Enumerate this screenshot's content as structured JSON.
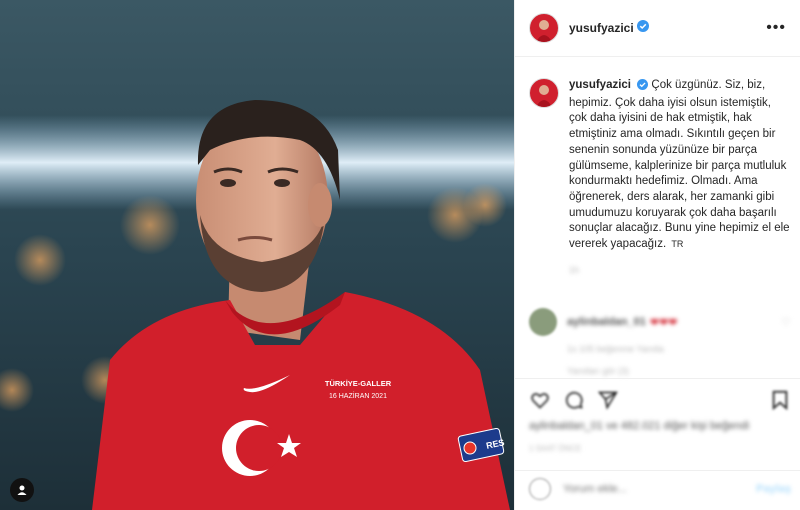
{
  "post": {
    "photo_alt": "",
    "jersey_text_line1": "TÜRKİYE-GALLER",
    "jersey_text_line2": "16 HAZİRAN 2021",
    "sleeve_badge": "RES"
  },
  "header": {
    "username": "yusufyazici",
    "more_label": "•••"
  },
  "caption": {
    "username": "yusufyazici",
    "text": "Çok üzgünüz. Siz, biz, hepimiz. Çok daha iyisi olsun istemiştik, çok daha iyisini de hak etmiştik, hak etmiştiniz ama olmadı. Sıkıntılı geçen bir senenin sonunda yüzünüze bir parça gülümseme, kalplerinize bir parça mutluluk kondurmaktı hedefimiz. Olmadı. Ama öğrenerek, ders alarak, her zamanki gibi umudumuzu koruyarak çok daha başarılı sonuçlar alacağız. Bunu yine hepimiz el ele vererek yapacağız.",
    "lang_badge": "TR",
    "time_blurred": "1h"
  },
  "comment": {
    "username_blurred": "aylinbaldan_01",
    "text_blurred": "❤❤❤",
    "meta_blurred": "1s  105 beğenme  Yanıtla",
    "replies_blurred": "Yanıtları gör (3)"
  },
  "likes_blurred": "aylinbaldan_01 ve 482.021 diğer kişi beğendi",
  "date_blurred": "1 SAAT ÖNCE",
  "add_comment": {
    "placeholder": "Yorum ekle...",
    "post_label": "Paylaş"
  },
  "colors": {
    "jersey": "#d11f2b",
    "verified": "#3897f0",
    "text": "#262626"
  }
}
